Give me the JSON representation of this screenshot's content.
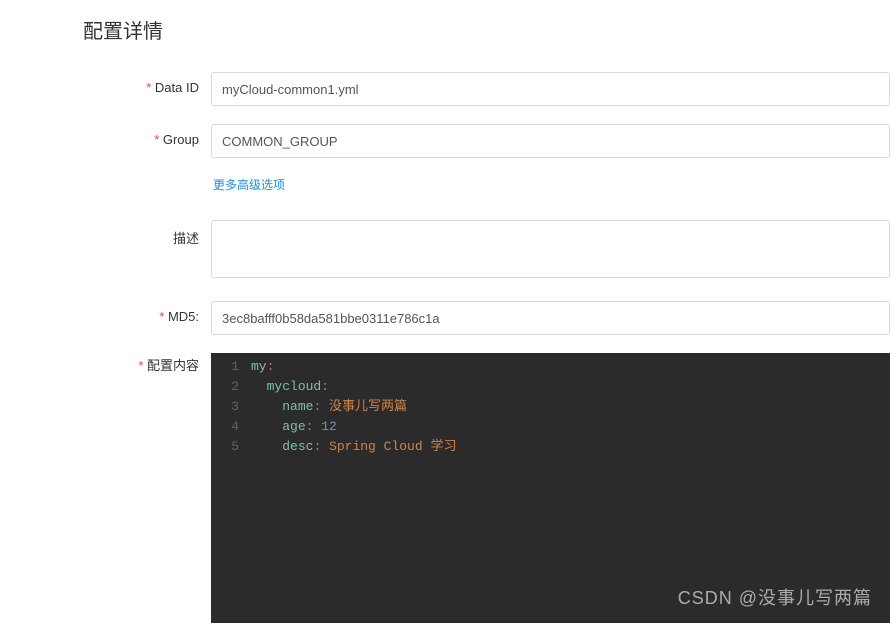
{
  "page": {
    "title": "配置详情"
  },
  "form": {
    "dataId": {
      "label": "Data ID",
      "value": "myCloud-common1.yml"
    },
    "group": {
      "label": "Group",
      "value": "COMMON_GROUP"
    },
    "advancedLink": "更多高级选项",
    "description": {
      "label": "描述",
      "value": ""
    },
    "md5": {
      "label": "MD5:",
      "value": "3ec8bafff0b58da581bbe0311e786c1a"
    },
    "content": {
      "label": "配置内容",
      "lines": [
        {
          "n": "1",
          "tokens": [
            {
              "t": "my",
              "c": "tok-key"
            },
            {
              "t": ":",
              "c": "tok-colon"
            }
          ]
        },
        {
          "n": "2",
          "tokens": [
            {
              "t": "  ",
              "c": ""
            },
            {
              "t": "mycloud",
              "c": "tok-key"
            },
            {
              "t": ":",
              "c": "tok-colon"
            }
          ]
        },
        {
          "n": "3",
          "tokens": [
            {
              "t": "    ",
              "c": ""
            },
            {
              "t": "name",
              "c": "tok-key"
            },
            {
              "t": ": ",
              "c": "tok-colon"
            },
            {
              "t": "没事儿写两篇",
              "c": "tok-string"
            }
          ]
        },
        {
          "n": "4",
          "tokens": [
            {
              "t": "    ",
              "c": ""
            },
            {
              "t": "age",
              "c": "tok-key"
            },
            {
              "t": ": ",
              "c": "tok-colon"
            },
            {
              "t": "12",
              "c": "tok-num"
            }
          ]
        },
        {
          "n": "5",
          "tokens": [
            {
              "t": "    ",
              "c": ""
            },
            {
              "t": "desc",
              "c": "tok-key"
            },
            {
              "t": ": ",
              "c": "tok-colon"
            },
            {
              "t": "Spring Cloud 学习",
              "c": "tok-string"
            }
          ]
        }
      ]
    }
  },
  "watermark": "CSDN @没事儿写两篇"
}
